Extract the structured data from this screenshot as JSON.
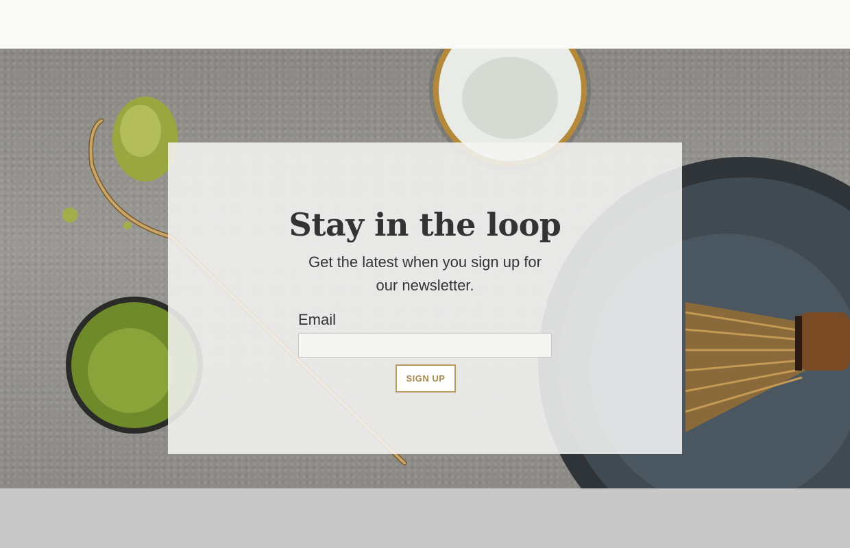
{
  "newsletter": {
    "title": "Stay in the loop",
    "subtitle": "Get the latest when you sign up for our newsletter.",
    "email_label": "Email",
    "email_value": "",
    "signup_label": "SIGN UP"
  },
  "colors": {
    "accent": "#b89a5c",
    "text": "#333333",
    "footer_band": "#c8c8c8"
  },
  "hero_image": {
    "subject": "matcha tea set on stone surface",
    "icons": [
      "matcha-powder-pile",
      "bamboo-scoop",
      "tea-bowl",
      "matcha-cup",
      "whisk-bowl",
      "bamboo-whisk"
    ]
  }
}
